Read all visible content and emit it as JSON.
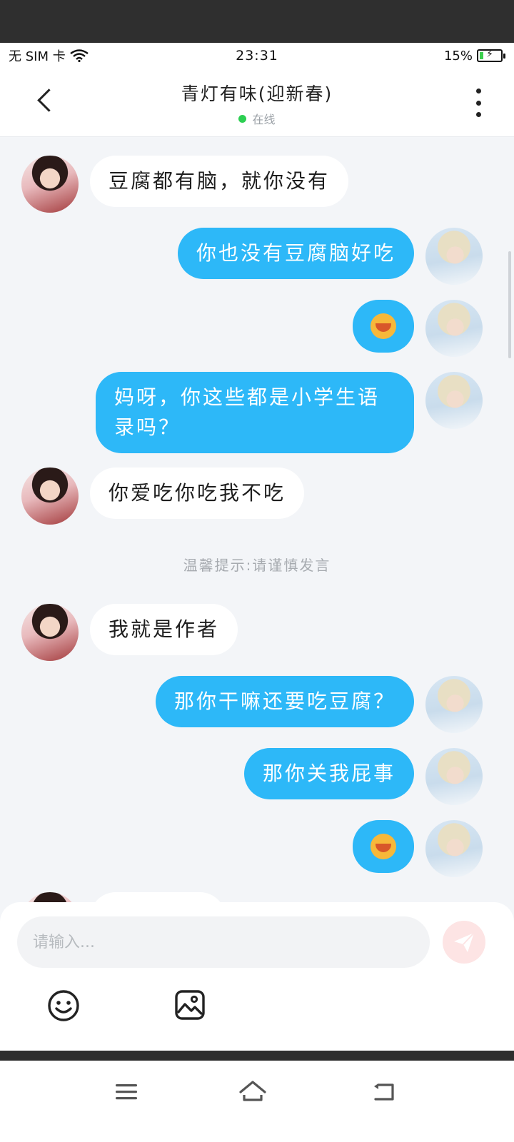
{
  "status_bar": {
    "carrier": "无 SIM 卡",
    "time": "23:31",
    "battery": "15%"
  },
  "header": {
    "title": "青灯有味(迎新春)",
    "presence": "在线"
  },
  "messages": [
    {
      "side": "in",
      "text": "豆腐都有脑，就你没有"
    },
    {
      "side": "out",
      "text": "你也没有豆腐脑好吃"
    },
    {
      "side": "out",
      "text": "",
      "emoji": "laughing-emoji"
    },
    {
      "side": "out",
      "text": "妈呀，你这些都是小学生语录吗？"
    },
    {
      "side": "in",
      "text": "你爱吃你吃我不吃"
    },
    {
      "side": "in",
      "text": "我就是作者"
    },
    {
      "side": "out",
      "text": "那你干嘛还要吃豆腐？"
    },
    {
      "side": "out",
      "text": "那你关我屁事"
    },
    {
      "side": "out",
      "text": "",
      "emoji": "laughing-emoji"
    }
  ],
  "system_tip": "温馨提示:请谨慎发言",
  "composer": {
    "placeholder": "请输入...",
    "send_icon": "paper-plane-icon",
    "emoji_icon": "smiley-icon",
    "image_icon": "image-icon"
  },
  "colors": {
    "out_bubble": "#2db8f8",
    "in_bubble": "#ffffff",
    "chat_bg": "#f3f5f8",
    "online": "#2ccf52"
  }
}
